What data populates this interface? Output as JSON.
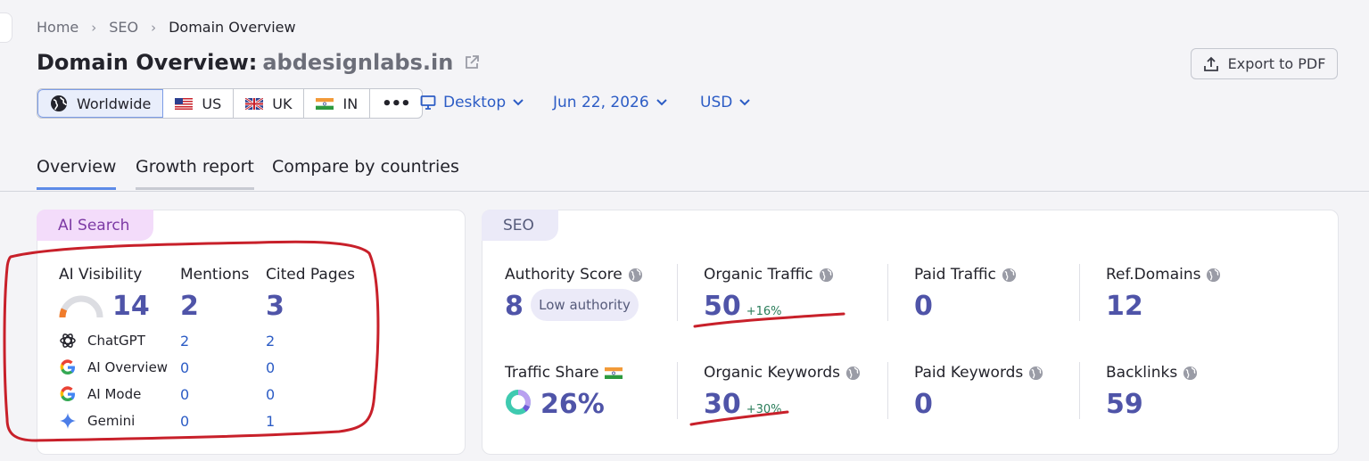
{
  "breadcrumb": {
    "home": "Home",
    "seo": "SEO",
    "current": "Domain Overview"
  },
  "title": {
    "prefix": "Domain Overview:",
    "domain": "abdesignlabs.in"
  },
  "export_label": "Export to PDF",
  "databases": [
    {
      "label": "Worldwide",
      "icon": "globe-icon"
    },
    {
      "label": "US",
      "icon": "us-flag-icon"
    },
    {
      "label": "UK",
      "icon": "uk-flag-icon"
    },
    {
      "label": "IN",
      "icon": "india-flag-icon"
    },
    {
      "label": "•••",
      "icon": "more-icon"
    }
  ],
  "selectors": {
    "device": "Desktop",
    "date": "Jun 22, 2026",
    "currency": "USD"
  },
  "tabs": [
    "Overview",
    "Growth report",
    "Compare by countries"
  ],
  "ai_search": {
    "pill": "AI Search",
    "headers": {
      "visibility": "AI Visibility",
      "mentions": "Mentions",
      "cited": "Cited Pages"
    },
    "totals": {
      "visibility": "14",
      "mentions": "2",
      "cited": "3"
    },
    "sources": [
      {
        "name": "ChatGPT",
        "mentions": "2",
        "cited": "2",
        "icon": "chatgpt-icon"
      },
      {
        "name": "AI Overview",
        "mentions": "0",
        "cited": "0",
        "icon": "google-icon"
      },
      {
        "name": "AI Mode",
        "mentions": "0",
        "cited": "0",
        "icon": "google-icon"
      },
      {
        "name": "Gemini",
        "mentions": "0",
        "cited": "1",
        "icon": "gemini-icon"
      }
    ]
  },
  "seo": {
    "pill": "SEO",
    "authority": {
      "label": "Authority Score",
      "value": "8",
      "badge": "Low authority"
    },
    "organic_traffic": {
      "label": "Organic Traffic",
      "value": "50",
      "delta": "+16%"
    },
    "paid_traffic": {
      "label": "Paid Traffic",
      "value": "0"
    },
    "ref_domains": {
      "label": "Ref.Domains",
      "value": "12"
    },
    "traffic_share": {
      "label": "Traffic Share",
      "value": "26%"
    },
    "organic_keywords": {
      "label": "Organic Keywords",
      "value": "30",
      "delta": "+30%"
    },
    "paid_keywords": {
      "label": "Paid Keywords",
      "value": "0"
    },
    "backlinks": {
      "label": "Backlinks",
      "value": "59"
    }
  },
  "colors": {
    "accent_blue": "#2c5cc5",
    "metric_purple": "#4f54a8",
    "annotation_red": "#c8202a",
    "delta_green": "#2a7d5a"
  }
}
